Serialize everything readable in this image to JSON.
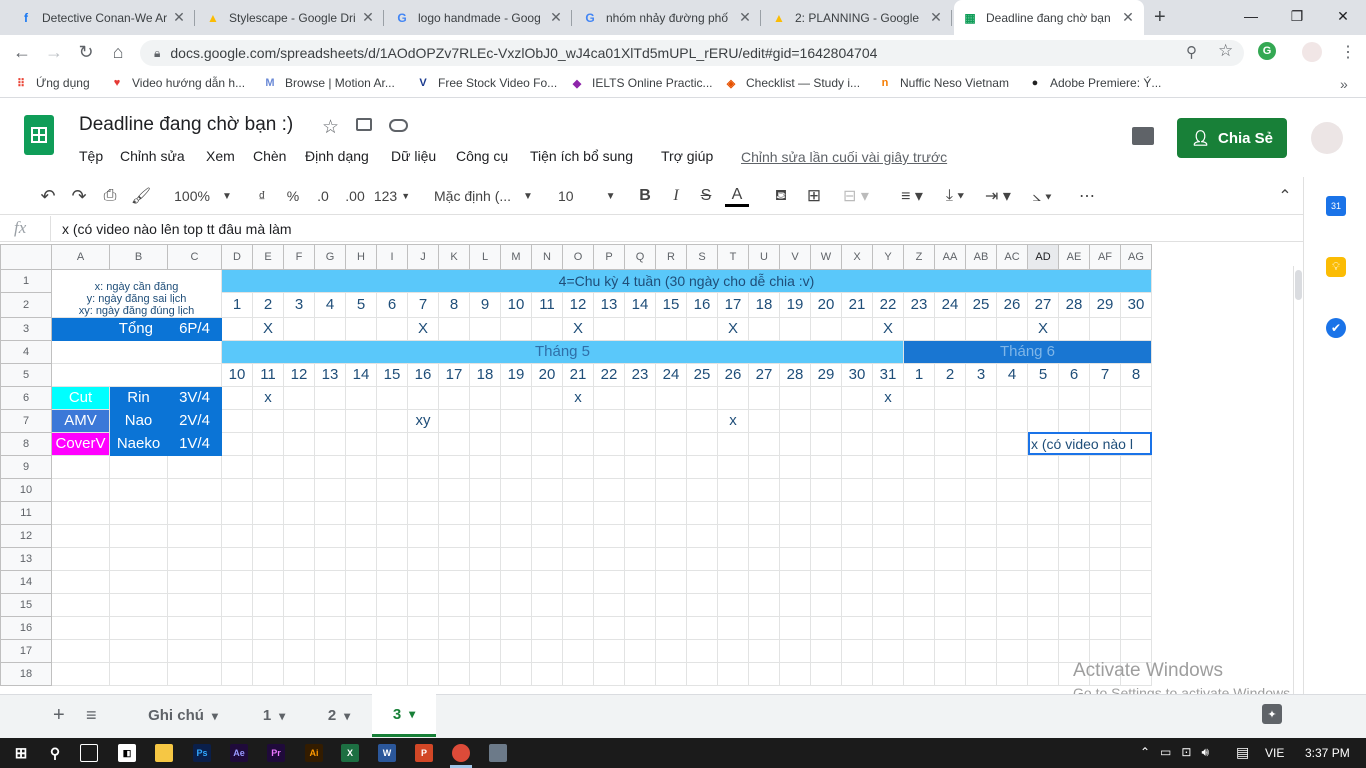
{
  "browser": {
    "tabs": [
      {
        "title": "Detective Conan-We Ar",
        "icon": "facebook-icon",
        "color": "#1877f2",
        "glyph": "f"
      },
      {
        "title": "Stylescape - Google Dri",
        "icon": "drive-icon",
        "color": "#fbbc04",
        "glyph": "▲"
      },
      {
        "title": "logo handmade - Goog",
        "icon": "google-icon",
        "color": "#4285f4",
        "glyph": "G"
      },
      {
        "title": "nhóm nhảy đường phố",
        "icon": "google-icon",
        "color": "#4285f4",
        "glyph": "G"
      },
      {
        "title": "2: PLANNING - Google",
        "icon": "drive-icon",
        "color": "#fbbc04",
        "glyph": "▲"
      },
      {
        "title": "Deadline đang chờ bạn",
        "icon": "sheets-icon",
        "color": "#0f9d58",
        "glyph": "▦"
      }
    ],
    "url": "docs.google.com/spreadsheets/d/1AOdOPZv7RLEc-VxzlObJ0_wJ4ca01XlTd5mUPL_rERU/edit#gid=1642804704",
    "bookmarks": [
      {
        "label": "Ứng dụng",
        "color": "#ea4335",
        "glyph": "⠿"
      },
      {
        "label": "Video hướng dẫn h...",
        "color": "#e53935",
        "glyph": "♥"
      },
      {
        "label": "Browse | Motion Ar...",
        "color": "#6b8ad6",
        "glyph": "M"
      },
      {
        "label": "Free Stock Video Fo...",
        "color": "#1a3a8f",
        "glyph": "V"
      },
      {
        "label": "IELTS Online Practic...",
        "color": "#8e24aa",
        "glyph": "◆"
      },
      {
        "label": "Checklist — Study i...",
        "color": "#e65100",
        "glyph": "◈"
      },
      {
        "label": "Nuffic Neso Vietnam",
        "color": "#f57c00",
        "glyph": "n"
      },
      {
        "label": "Adobe Premiere: Ý...",
        "color": "#222",
        "glyph": "●"
      }
    ]
  },
  "doc": {
    "title": "Deadline đang chờ bạn :)",
    "menus": [
      "Tệp",
      "Chỉnh sửa",
      "Xem",
      "Chèn",
      "Định dạng",
      "Dữ liệu",
      "Công cụ",
      "Tiện ích bổ sung",
      "Trợ giúp"
    ],
    "last_edit": "Chỉnh sửa lần cuối vài giây trước",
    "share": "Chia Sẻ"
  },
  "toolbar": {
    "zoom": "100%",
    "currency": "₫",
    "percent": "%",
    "dec_less": ".0",
    "dec_more": ".00",
    "format": "123",
    "font": "Mặc định (...",
    "size": "10",
    "bold": "B",
    "italic": "I",
    "strike": "S",
    "textcolor": "A",
    "more": "⋯"
  },
  "formula": {
    "fx": "fx",
    "value": "x (có video nào lên top tt đâu mà làm"
  },
  "grid": {
    "col_headers": [
      "A",
      "B",
      "C",
      "D",
      "E",
      "F",
      "G",
      "H",
      "I",
      "J",
      "K",
      "L",
      "M",
      "N",
      "O",
      "P",
      "Q",
      "R",
      "S",
      "T",
      "U",
      "V",
      "W",
      "X",
      "Y",
      "Z",
      "AA",
      "AB",
      "AC",
      "AD",
      "AE",
      "AF",
      "AG"
    ],
    "row_headers": [
      "1",
      "2",
      "3",
      "4",
      "5",
      "6",
      "7",
      "8",
      "9",
      "10",
      "11",
      "12",
      "13",
      "14",
      "15",
      "16",
      "17",
      "18"
    ],
    "legend": [
      "x: ngày cần đăng",
      "y: ngày đăng sai lịch",
      "xy: ngày đăng đúng lịch"
    ],
    "cycle_title": "4=Chu kỳ 4 tuần (30 ngày cho dễ chia :v)",
    "cycle_days": [
      "1",
      "2",
      "3",
      "4",
      "5",
      "6",
      "7",
      "8",
      "9",
      "10",
      "11",
      "12",
      "13",
      "14",
      "15",
      "16",
      "17",
      "18",
      "19",
      "20",
      "21",
      "22",
      "23",
      "24",
      "25",
      "26",
      "27",
      "28",
      "29",
      "30"
    ],
    "total_label": "Tổng",
    "total_value": "6P/4",
    "row3_marks": {
      "E": "X",
      "J": "X",
      "O": "X",
      "T": "X",
      "Y": "X",
      "AD": "X"
    },
    "month5": "Tháng 5",
    "month6": "Tháng 6",
    "dates": [
      "10",
      "11",
      "12",
      "13",
      "14",
      "15",
      "16",
      "17",
      "18",
      "19",
      "20",
      "21",
      "22",
      "23",
      "24",
      "25",
      "26",
      "27",
      "28",
      "29",
      "30",
      "31",
      "1",
      "2",
      "3",
      "4",
      "5",
      "6",
      "7",
      "8"
    ],
    "categories": [
      {
        "type": "Cut",
        "name": "Rin",
        "freq": "3V/4",
        "color": "#00ffff"
      },
      {
        "type": "AMV",
        "name": "Nao",
        "freq": "2V/4",
        "color": "#3c78d8"
      },
      {
        "type": "CoverV",
        "name": "Naeko",
        "freq": "1V/4",
        "color": "#ff00ff"
      }
    ],
    "row6_marks": {
      "E": "x",
      "O": "x",
      "Y": "x"
    },
    "row7_marks": {
      "J": "xy",
      "T": "x"
    },
    "row8_note": "x (có video nào l"
  },
  "watermark": {
    "line1": "Activate Windows",
    "line2": "Go to Settings to activate Windows."
  },
  "sheets": {
    "tabs": [
      "Ghi chú",
      "1",
      "2",
      "3"
    ],
    "active": "3"
  },
  "taskbar": {
    "lang": "VIE",
    "time": "3:37 PM"
  }
}
